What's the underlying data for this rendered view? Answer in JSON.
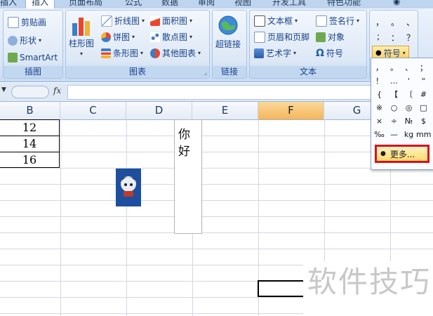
{
  "tabs": [
    "插入",
    "页面布局",
    "公式",
    "数据",
    "审阅",
    "视图",
    "开发工具",
    "特色功能"
  ],
  "ribbon": {
    "illustrations": {
      "clipart": "剪贴画",
      "shapes": "形状",
      "smartart": "SmartArt",
      "label": "插图"
    },
    "charts": {
      "column": "柱形图",
      "line": "折线图",
      "pie": "饼图",
      "bar": "条形图",
      "area": "面积图",
      "scatter": "散点图",
      "other": "其他图表",
      "label": "图表"
    },
    "links": {
      "hyperlink": "超链接",
      "label": "链接"
    },
    "text": {
      "textbox": "文本框",
      "header_footer": "页眉和页脚",
      "wordart": "艺术字",
      "signature": "签名行",
      "object": "对象",
      "symbol": "符号",
      "label": "文本"
    },
    "symbols_group": {
      "top_row": [
        "，",
        "。",
        "、"
      ],
      "second_row": [
        ";",
        "：",
        "？"
      ],
      "symbol_button": "符号"
    }
  },
  "formula_bar": {
    "fx": "fx"
  },
  "columns": [
    "B",
    "C",
    "D",
    "E",
    "F",
    "G"
  ],
  "selected_column": "F",
  "cells": [
    "12",
    "14",
    "16"
  ],
  "textbox_chars": [
    "你",
    "好"
  ],
  "symbol_menu": {
    "rows": [
      [
        "，",
        "。",
        "、",
        "；"
      ],
      [
        "！",
        "…",
        "‘",
        "“"
      ],
      [
        "{",
        "【",
        "〔",
        "#"
      ],
      [
        "※",
        "○",
        "◎",
        "□"
      ],
      [
        "×",
        "÷",
        "№",
        "$"
      ],
      [
        "‰",
        "—",
        "kg",
        "mm"
      ]
    ],
    "more_label": "更多..."
  },
  "watermark": "软件技巧",
  "colors": {
    "ribbon": "#dbe7f6",
    "selected_header": "#f6b55a",
    "highlight_border": "#d8121e",
    "accent": "#15428b"
  }
}
